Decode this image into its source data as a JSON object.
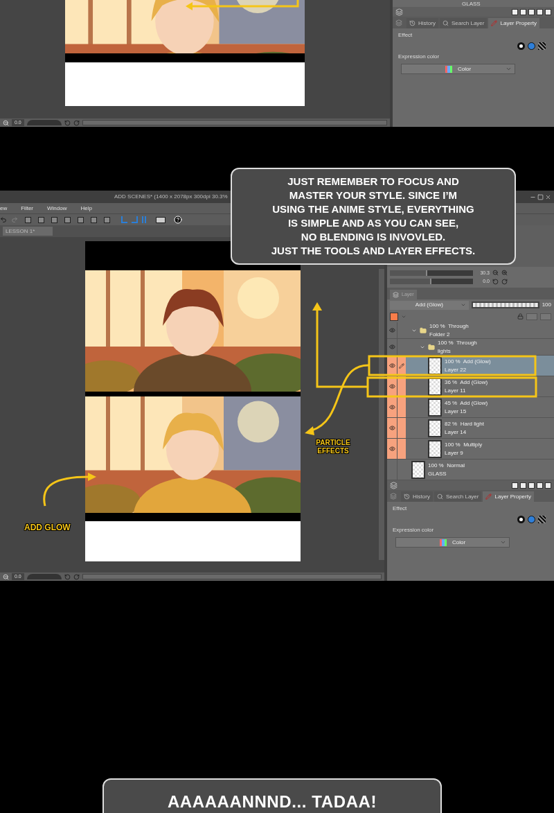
{
  "top_screenshot": {
    "status_bar": {
      "zoom_value": "0.0"
    },
    "layer_panel": {
      "partial_layer": "GLASS"
    },
    "panel_tabs": [
      {
        "label": "History",
        "selected": false
      },
      {
        "label": "Search Layer",
        "selected": false
      },
      {
        "label": "Layer Property",
        "selected": true
      }
    ],
    "property": {
      "effect_label": "Effect",
      "expression_color_label": "Expression color",
      "expression_color_value": "Color"
    }
  },
  "window": {
    "title": "ADD SCENES* (1400 x 2078px 300dpi 30.3%",
    "menu": [
      "ew",
      "Filter",
      "Window",
      "Help"
    ],
    "document_tabs": [
      {
        "label": "LESSON 1*",
        "selected": true
      }
    ],
    "navigator": {
      "zoom": "30.3",
      "zoom_slider": {
        "level": 0.45
      },
      "rotation": "0.0",
      "rotation_slider": {
        "level": 0.5
      }
    },
    "layer_panel": {
      "tab": "Layer",
      "blend_mode": "Add (Glow)",
      "opacity": "100",
      "opacity_slider": {
        "level": 1
      },
      "layers": [
        {
          "kind": "folder",
          "name": "Folder 2",
          "blend": "100 %  Through",
          "expanded": true,
          "visible": true,
          "marked": false,
          "selected": false,
          "children": [
            {
              "kind": "folder",
              "name": "lights",
              "blend": "100 %  Through",
              "expanded": true,
              "visible": true,
              "marked": false,
              "selected": false,
              "children": [
                {
                  "kind": "raster",
                  "name": "Layer 22",
                  "blend": "100 %  Add (Glow)",
                  "visible": true,
                  "marked": true,
                  "selected": true
                },
                {
                  "kind": "raster",
                  "name": "Layer 11",
                  "blend": "36 %  Add (Glow)",
                  "visible": true,
                  "marked": true,
                  "selected": false
                },
                {
                  "kind": "raster",
                  "name": "Layer 15",
                  "blend": "45 %  Add (Glow)",
                  "visible": true,
                  "marked": true,
                  "selected": false
                },
                {
                  "kind": "raster",
                  "name": "Layer 14",
                  "blend": "82 %  Hard light",
                  "visible": true,
                  "marked": true,
                  "selected": false
                },
                {
                  "kind": "raster",
                  "name": "Layer 9",
                  "blend": "100 %  Multiply",
                  "visible": true,
                  "marked": true,
                  "selected": false
                }
              ]
            }
          ]
        },
        {
          "kind": "raster",
          "name": "GLASS",
          "blend": "100 %  Normal",
          "visible": false,
          "marked": false,
          "selected": false
        }
      ]
    },
    "panel_tabs": [
      {
        "label": "History",
        "selected": false
      },
      {
        "label": "Search Layer",
        "selected": false
      },
      {
        "label": "Layer Property",
        "selected": true
      }
    ],
    "property": {
      "effect_label": "Effect",
      "expression_color_label": "Expression color",
      "expression_color_value": "Color"
    },
    "status_bar": {
      "zoom_value": "0.0"
    }
  },
  "callout": {
    "lines": [
      "JUST REMEMBER TO FOCUS AND",
      "MASTER YOUR STYLE. SINCE I’M",
      "USING THE ANIME STYLE, EVERYTHING",
      "IS SIMPLE AND AS YOU CAN SEE,",
      "NO BLENDING IS INVOVLED.",
      "JUST THE TOOLS AND LAYER EFFECTS."
    ]
  },
  "particle_label": "PARTICLE EFFECTS",
  "glow_label": "ADD GLOW",
  "bottom_callout": {
    "text": "AAAAAANNND... TADAA!"
  }
}
